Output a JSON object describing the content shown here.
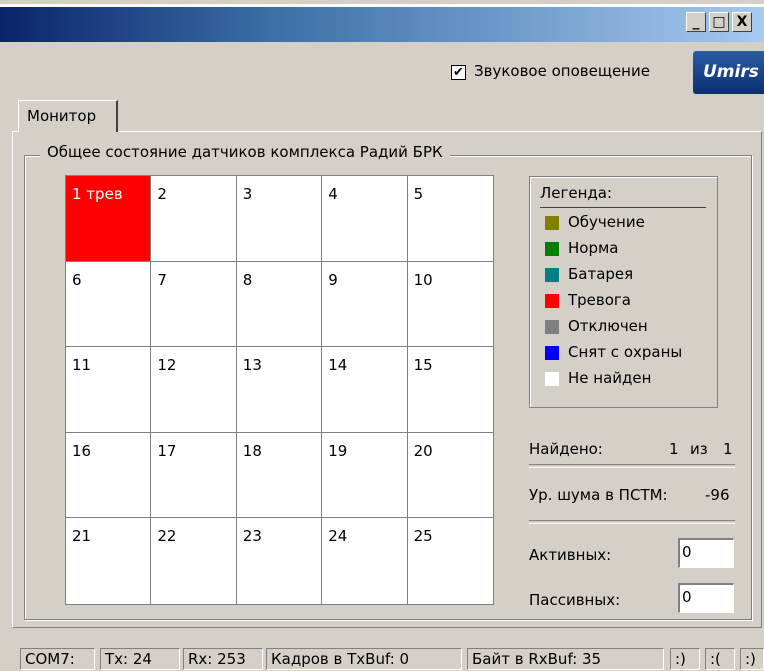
{
  "window": {
    "buttons": {
      "minimize": "_",
      "maximize": "□",
      "close": "X"
    }
  },
  "toolbar": {
    "sound_alert_label": "Звуковое оповещение",
    "sound_alert_checked": true,
    "logo_text": "Umirs"
  },
  "tabs": [
    {
      "label": "Монитор",
      "active": true
    }
  ],
  "group": {
    "title": "Общее состояние датчиков комплекса Радий БРК"
  },
  "sensor_grid": {
    "cells": [
      {
        "label": "1 трев",
        "state": "Тревога"
      },
      {
        "label": "2"
      },
      {
        "label": "3"
      },
      {
        "label": "4"
      },
      {
        "label": "5"
      },
      {
        "label": "6"
      },
      {
        "label": "7"
      },
      {
        "label": "8"
      },
      {
        "label": "9"
      },
      {
        "label": "10"
      },
      {
        "label": "11"
      },
      {
        "label": "12"
      },
      {
        "label": "13"
      },
      {
        "label": "14"
      },
      {
        "label": "15"
      },
      {
        "label": "16"
      },
      {
        "label": "17"
      },
      {
        "label": "18"
      },
      {
        "label": "19"
      },
      {
        "label": "20"
      },
      {
        "label": "21"
      },
      {
        "label": "22"
      },
      {
        "label": "23"
      },
      {
        "label": "24"
      },
      {
        "label": "25"
      }
    ]
  },
  "legend": {
    "title": "Легенда:",
    "items": [
      {
        "label": "Обучение",
        "color": "#808000"
      },
      {
        "label": "Норма",
        "color": "#008000"
      },
      {
        "label": "Батарея",
        "color": "#008080"
      },
      {
        "label": "Тревога",
        "color": "#ff0000"
      },
      {
        "label": "Отключен",
        "color": "#808080"
      },
      {
        "label": "Снят с охраны",
        "color": "#0000ff"
      },
      {
        "label": "Не найден",
        "color": "#ffffff"
      }
    ]
  },
  "stats": {
    "found_label": "Найдено:",
    "found_value": "1",
    "of_label": "из",
    "total_value": "1",
    "noise_label": "Ур. шума в ПСТМ:",
    "noise_value": "-96",
    "active_label": "Активных:",
    "active_value": "0",
    "passive_label": "Пассивных:",
    "passive_value": "0"
  },
  "statusbar": {
    "port": "COM7:",
    "tx": "Tx: 24",
    "rx": "Rx: 253",
    "tx_buf": "Кадров в TxBuf: 0",
    "rx_buf": "Байт в RxBuf: 35",
    "ind1": ":)",
    "ind2": ":(",
    "ind3": ":)"
  }
}
